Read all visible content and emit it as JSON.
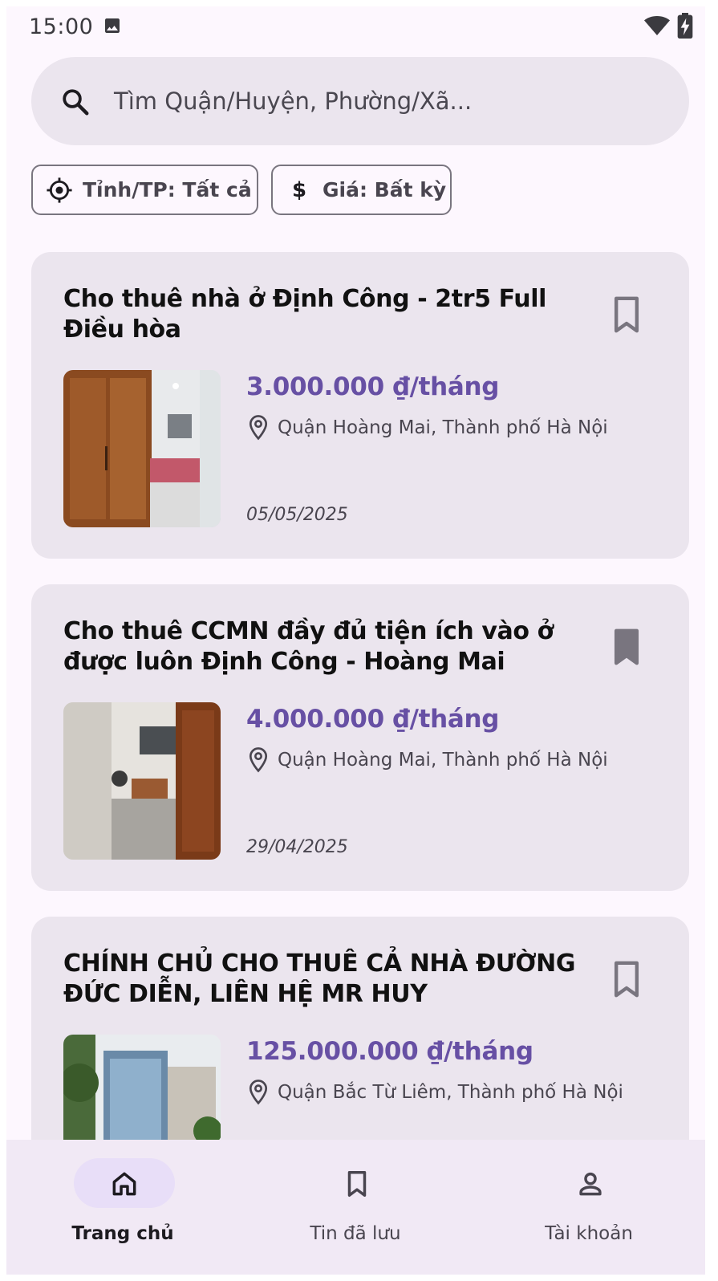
{
  "status_bar": {
    "time": "15:00",
    "icons": [
      "image-icon",
      "wifi-icon",
      "battery-charging-icon"
    ]
  },
  "search": {
    "placeholder": "Tìm Quận/Huyện, Phường/Xã...",
    "icon": "search-icon"
  },
  "filters": {
    "province_label": "Tỉnh/TP: Tất cả",
    "province_icon": "location-target-icon",
    "price_label": "Giá: Bất kỳ",
    "price_icon": "dollar-icon"
  },
  "listings": [
    {
      "title": "Cho thuê nhà ở Định Công - 2tr5 Full Điều hòa",
      "price": "3.000.000 ₫/tháng",
      "location": "Quận Hoàng Mai, Thành phố Hà Nội",
      "date": "05/05/2025",
      "saved": false
    },
    {
      "title": "Cho thuê CCMN đầy đủ tiện ích vào ở được luôn Định Công - Hoàng Mai",
      "price": "4.000.000 ₫/tháng",
      "location": "Quận Hoàng Mai, Thành phố Hà Nội",
      "date": "29/04/2025",
      "saved": true
    },
    {
      "title": "CHÍNH CHỦ CHO THUÊ CẢ NHÀ ĐƯỜNG ĐỨC DIỄN, LIÊN HỆ MR HUY",
      "price": "125.000.000 ₫/tháng",
      "location": "Quận Bắc Từ Liêm, Thành phố Hà Nội",
      "date": "",
      "saved": false
    }
  ],
  "bottom_nav": {
    "items": [
      {
        "label": "Trang chủ",
        "icon": "home-icon",
        "active": true
      },
      {
        "label": "Tin đã lưu",
        "icon": "bookmark-icon",
        "active": false
      },
      {
        "label": "Tài khoản",
        "icon": "person-icon",
        "active": false
      }
    ]
  },
  "colors": {
    "accent": "#6750a4",
    "card_bg": "#ebe5ee",
    "screen_bg": "#fdf7fe",
    "nav_bg": "#f1e9f5",
    "nav_indicator": "#e8def8"
  }
}
